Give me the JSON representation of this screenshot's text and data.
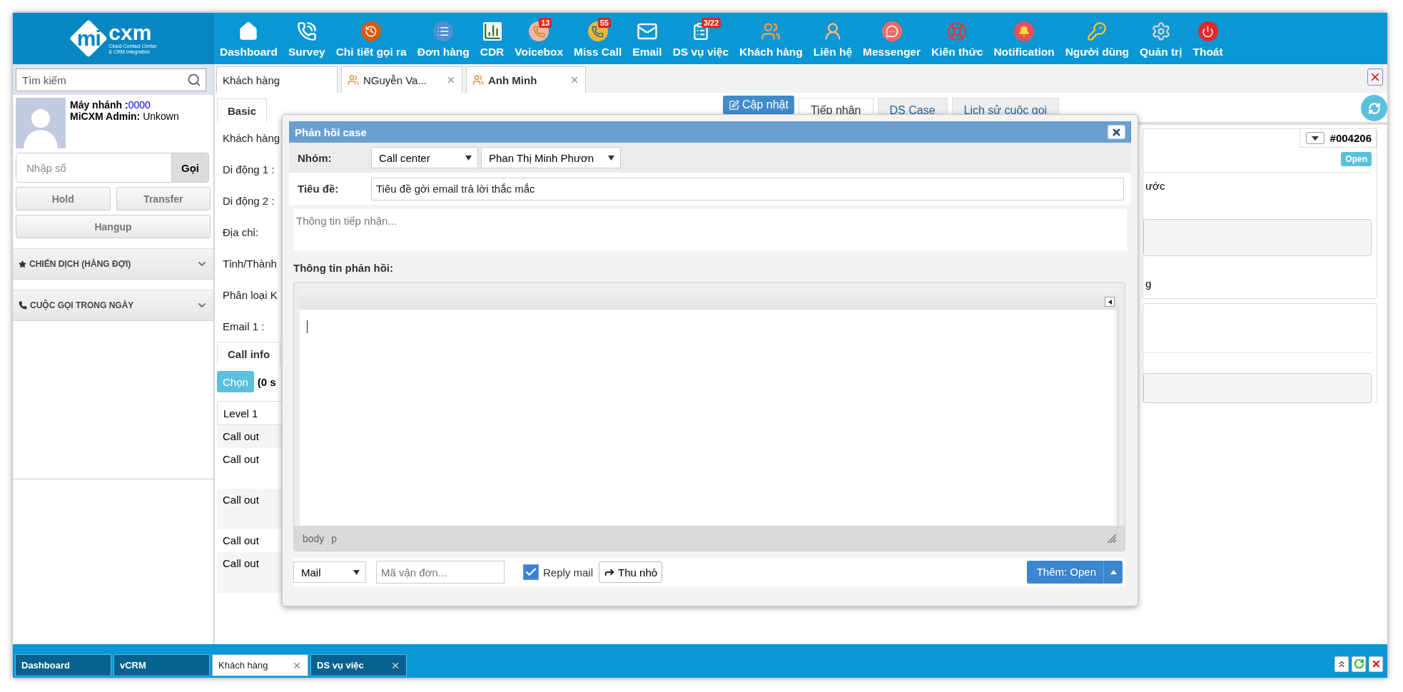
{
  "logo": {
    "mark": "mi",
    "name": "cxm",
    "tagline": [
      "Cloud Contact Center",
      "& CRM Integration"
    ]
  },
  "nav": [
    {
      "label": "Dashboard"
    },
    {
      "label": "Survey"
    },
    {
      "label": "Chi tiết gọi ra"
    },
    {
      "label": "Đơn hàng"
    },
    {
      "label": "CDR"
    },
    {
      "label": "Voicebox",
      "badge": "13"
    },
    {
      "label": "Miss Call",
      "badge": "55"
    },
    {
      "label": "Email"
    },
    {
      "label": "DS vụ việc",
      "badge": "3/22"
    },
    {
      "label": "Khách hàng"
    },
    {
      "label": "Liên hệ"
    },
    {
      "label": "Messenger"
    },
    {
      "label": "Kiến thức"
    },
    {
      "label": "Notification"
    },
    {
      "label": "Người dùng"
    },
    {
      "label": "Quản trị"
    },
    {
      "label": "Thoát"
    }
  ],
  "sidebar": {
    "search": {
      "placeholder": "Tìm kiếm"
    },
    "extension_label": "Máy nhánh :",
    "extension": "0000",
    "user_label": "MiCXM Admin:",
    "user_status": "Unkown",
    "dial": {
      "placeholder": "Nhập số",
      "button": "Gọi"
    },
    "call_buttons": [
      "Hold",
      "Transfer"
    ],
    "hangup_button": "Hangup",
    "sections": [
      {
        "title": "CHIẾN DỊCH (HÀNG ĐỢI)"
      },
      {
        "title": "CUỘC GỌI TRONG NGÀY"
      }
    ]
  },
  "tabs": [
    {
      "label": "Khách hàng",
      "kind": "module",
      "selected": false
    },
    {
      "label": "NGuyễn Va...",
      "kind": "record",
      "selected": false
    },
    {
      "label": "Anh Minh",
      "kind": "record",
      "selected": true
    }
  ],
  "form": {
    "tabs": [
      {
        "label": "Basic",
        "selected": true
      }
    ],
    "labels": [
      "Khách hàng",
      "Di động 1 :",
      "Di động 2 :",
      "Địa chỉ:",
      "Tỉnh/Thành",
      "Phân loại K",
      "Email 1 :"
    ],
    "call_info_tab": "Call info",
    "choose_button": "Chọn",
    "selection_note": "(0 s",
    "table": {
      "columns": [
        "Level 1"
      ],
      "rows": [
        {
          "cells": [
            "Call out"
          ],
          "tall": false
        },
        {
          "cells": [
            "Call out"
          ],
          "tall": true
        },
        {
          "cells": [
            "Call out"
          ],
          "tall": true
        },
        {
          "cells": [
            "Call out"
          ],
          "tall": false
        },
        {
          "cells": [
            "Call out"
          ],
          "tall": true
        }
      ]
    }
  },
  "detail": {
    "update_button": "Cập nhật",
    "tabs": [
      {
        "label": "Tiếp nhận",
        "selected": true
      },
      {
        "label": "DS Case",
        "selected": false
      },
      {
        "label": "Lịch sử cuộc gọi",
        "selected": false
      }
    ],
    "case_id": "#004206",
    "status": "Open",
    "fragments": [
      "ước",
      "g"
    ]
  },
  "dialog": {
    "title": "Phản hồi case",
    "group_label": "Nhóm:",
    "group": "Call center",
    "assignee": "Phan Thị Minh Phươn",
    "subject_label": "Tiêu đề:",
    "subject": "Tiêu đề gởi email trả lời thắc mắc",
    "intake_placeholder": "Thông tin tiếp nhận...",
    "reply_label": "Thông tin phản hồi:",
    "editor_path": [
      "body",
      "p"
    ],
    "channel": "Mail",
    "tracking_placeholder": "Mã vận đơn...",
    "reply_mail": {
      "label": "Reply mail",
      "checked": true
    },
    "minimize_button": "Thu nhỏ",
    "submit_button": "Thêm: Open"
  },
  "taskbar": [
    {
      "label": "Dashboard",
      "selected": false,
      "closable": false
    },
    {
      "label": "vCRM",
      "selected": false,
      "closable": false
    },
    {
      "label": "Khách hàng",
      "selected": true,
      "closable": true
    },
    {
      "label": "DS vụ việc",
      "selected": false,
      "closable": true
    }
  ]
}
